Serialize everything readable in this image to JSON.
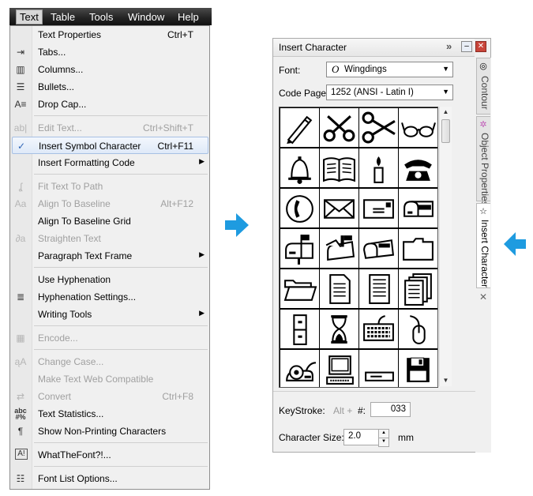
{
  "menubar": {
    "items": [
      {
        "label": "Text",
        "active": true
      },
      {
        "label": "Table"
      },
      {
        "label": "Tools"
      },
      {
        "label": "Window"
      },
      {
        "label": "Help"
      }
    ]
  },
  "menu": {
    "items": [
      {
        "label": "Text Properties",
        "shortcut": "Ctrl+T",
        "icon": "none",
        "enabled": true
      },
      {
        "label": "Tabs...",
        "icon": "tabs-icon",
        "enabled": true
      },
      {
        "label": "Columns...",
        "icon": "columns-icon",
        "enabled": true
      },
      {
        "label": "Bullets...",
        "icon": "bullets-icon",
        "enabled": true
      },
      {
        "label": "Drop Cap...",
        "icon": "drop-cap-icon",
        "enabled": true
      },
      {
        "label": "Edit Text...",
        "shortcut": "Ctrl+Shift+T",
        "icon": "edit-text-icon",
        "enabled": false
      },
      {
        "label": "Insert Symbol Character",
        "shortcut": "Ctrl+F11",
        "icon": "checkmark-icon",
        "enabled": true,
        "highlighted": true
      },
      {
        "label": "Insert Formatting Code",
        "icon": "none",
        "enabled": true,
        "submenu": true
      },
      {
        "label": "Fit Text To Path",
        "icon": "fit-text-to-path-icon",
        "enabled": false
      },
      {
        "label": "Align To Baseline",
        "shortcut": "Alt+F12",
        "icon": "align-baseline-icon",
        "enabled": false
      },
      {
        "label": "Align To Baseline Grid",
        "icon": "none",
        "enabled": true
      },
      {
        "label": "Straighten Text",
        "icon": "straighten-text-icon",
        "enabled": false
      },
      {
        "label": "Paragraph Text Frame",
        "icon": "none",
        "enabled": true,
        "submenu": true
      },
      {
        "label": "Use Hyphenation",
        "icon": "none",
        "enabled": true
      },
      {
        "label": "Hyphenation Settings...",
        "icon": "hyphenation-icon",
        "enabled": true
      },
      {
        "label": "Writing Tools",
        "icon": "none",
        "enabled": true,
        "submenu": true
      },
      {
        "label": "Encode...",
        "icon": "encode-icon",
        "enabled": false
      },
      {
        "label": "Change Case...",
        "icon": "change-case-icon",
        "enabled": false
      },
      {
        "label": "Make Text Web Compatible",
        "icon": "none",
        "enabled": false
      },
      {
        "label": "Convert",
        "shortcut": "Ctrl+F8",
        "icon": "convert-icon",
        "enabled": false
      },
      {
        "label": "Text Statistics...",
        "icon": "text-statistics-icon",
        "enabled": true
      },
      {
        "label": "Show Non-Printing Characters",
        "icon": "pilcrow-icon",
        "enabled": true
      },
      {
        "label": "WhatTheFont?!...",
        "icon": "whatthefont-icon",
        "enabled": true
      },
      {
        "label": "Font List Options...",
        "icon": "font-list-icon",
        "enabled": true
      }
    ]
  },
  "panel": {
    "title": "Insert Character",
    "font_label": "Font:",
    "font_value": "Wingdings",
    "code_page_label": "Code Page:",
    "code_page_value": "1252  (ANSI - Latin I)",
    "keystroke_label": "KeyStroke:",
    "keystroke_prefix": "Alt +",
    "keystroke_hash": "#:",
    "keystroke_value": "033",
    "char_size_label": "Character Size:",
    "char_size_value": "2.0",
    "char_size_unit": "mm",
    "tabs": [
      "Contour",
      "Object Properties",
      "Insert Character"
    ],
    "glyphs": [
      "pencil",
      "scissors",
      "scissors-open",
      "glasses",
      "bell",
      "book",
      "candle",
      "telephone",
      "phone-handset",
      "envelope",
      "letter",
      "mailbox",
      "mailbox-flag",
      "mailbox-open",
      "mailbox-closed",
      "folder",
      "folder-open",
      "document",
      "document-lines",
      "documents-stack",
      "file-cabinet",
      "hourglass",
      "keyboard",
      "mouse",
      "trackball",
      "computer",
      "drive",
      "floppy-disk"
    ]
  },
  "colors": {
    "arrow": "#1e9be0",
    "highlight": "#dfe9f8"
  }
}
